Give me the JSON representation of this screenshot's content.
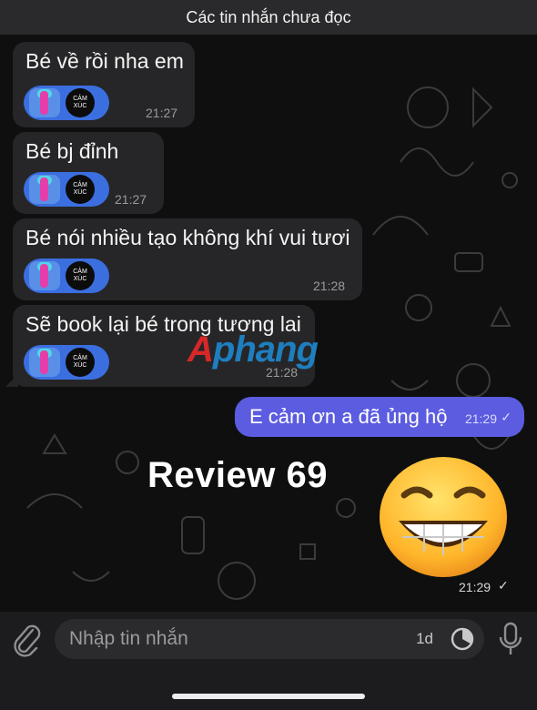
{
  "header": {
    "unread_label": "Các tin nhắn chưa đọc"
  },
  "messages": [
    {
      "text": "Bé về rồi nha em",
      "time": "21:27"
    },
    {
      "text": "Bé bj đỉnh",
      "time": "21:27"
    },
    {
      "text": "Bé nói nhiều tạo không khí vui tươi",
      "time": "21:28"
    },
    {
      "text": "Sẽ book lại bé trong tương lai",
      "time": "21:28"
    }
  ],
  "reaction": {
    "badge_line1": "CẢM",
    "badge_line2": "XÚC",
    "color": "#3b6fe0"
  },
  "outgoing": {
    "text": "E cảm ơn a đã ủng hộ",
    "time": "21:29",
    "status_icon": "check-icon",
    "color": "#5c5ce0"
  },
  "overlay": {
    "title": "Review 69",
    "watermark_first": "A",
    "watermark_rest": "phang"
  },
  "sticker": {
    "time": "21:29",
    "emoji": "grinning-face"
  },
  "composer": {
    "placeholder": "Nhập tin nhắn",
    "timer_label": "1d"
  }
}
